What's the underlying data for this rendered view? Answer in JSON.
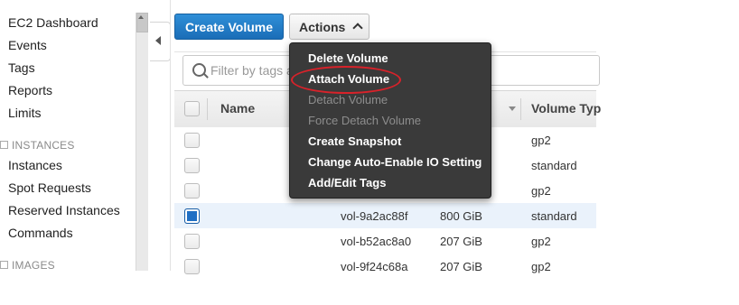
{
  "sidebar": {
    "items": [
      {
        "label": "EC2 Dashboard"
      },
      {
        "label": "Events"
      },
      {
        "label": "Tags"
      },
      {
        "label": "Reports"
      },
      {
        "label": "Limits"
      }
    ],
    "instances_section": {
      "title": "INSTANCES",
      "items": [
        {
          "label": "Instances"
        },
        {
          "label": "Spot Requests"
        },
        {
          "label": "Reserved Instances"
        },
        {
          "label": "Commands"
        }
      ]
    },
    "images_section": {
      "title": "IMAGES"
    }
  },
  "toolbar": {
    "create_label": "Create Volume",
    "actions_label": "Actions"
  },
  "search": {
    "placeholder": "Filter by tags a"
  },
  "table": {
    "headers": {
      "name": "Name",
      "volume_type": "Volume Typ"
    },
    "rows": [
      {
        "volume_id": "",
        "size": "",
        "type": "gp2",
        "selected": false
      },
      {
        "volume_id": "",
        "size": "",
        "type": "standard",
        "selected": false
      },
      {
        "volume_id": "",
        "size": "",
        "type": "gp2",
        "selected": false
      },
      {
        "volume_id": "vol-9a2ac88f",
        "size": "800 GiB",
        "type": "standard",
        "selected": true
      },
      {
        "volume_id": "vol-b52ac8a0",
        "size": "207 GiB",
        "type": "gp2",
        "selected": false
      },
      {
        "volume_id": "vol-9f24c68a",
        "size": "207 GiB",
        "type": "gp2",
        "selected": false
      }
    ]
  },
  "actions_menu": {
    "items": [
      {
        "label": "Delete Volume",
        "enabled": true
      },
      {
        "label": "Attach Volume",
        "enabled": true,
        "highlighted": true
      },
      {
        "label": "Detach Volume",
        "enabled": false
      },
      {
        "label": "Force Detach Volume",
        "enabled": false
      },
      {
        "label": "Create Snapshot",
        "enabled": true
      },
      {
        "label": "Change Auto-Enable IO Setting",
        "enabled": true
      },
      {
        "label": "Add/Edit Tags",
        "enabled": true
      }
    ]
  },
  "colors": {
    "primary_button": "#1a6db7",
    "menu_background": "#3a3a3a",
    "highlight_oval": "#d8222a",
    "selected_row": "#eaf2fb",
    "checkbox_checked": "#1f6fc4"
  }
}
